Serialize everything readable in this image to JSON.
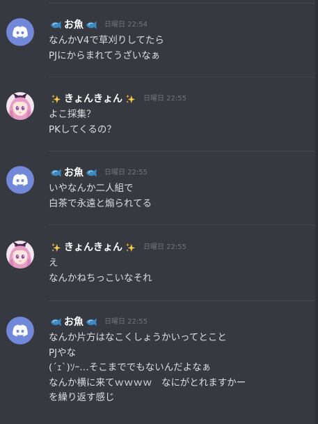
{
  "channel": {
    "messages": [
      {
        "username": "お魚",
        "avatar_icon": "discord-logo-icon",
        "name_icons": [
          "fish-icon",
          "fish-icon"
        ],
        "timestamp": "日曜日 22:54",
        "lines": [
          "なんかV4で草刈りしてたら",
          "PJにからまれてうざいなぁ"
        ]
      },
      {
        "username": "きょんきょん",
        "avatar_icon": "anime-girl-avatar-icon",
        "name_icons": [
          "sparkles-icon",
          "sparkles-icon"
        ],
        "timestamp": "日曜日 22:55",
        "lines": [
          "よこ採集？",
          "PKしてくるの？"
        ]
      },
      {
        "username": "お魚",
        "avatar_icon": "discord-logo-icon",
        "name_icons": [
          "fish-icon",
          "fish-icon"
        ],
        "timestamp": "日曜日 22:55",
        "lines": [
          "いやなんか二人組で",
          "白茶で永遠と煽られてる"
        ]
      },
      {
        "username": "きょんきょん",
        "avatar_icon": "anime-girl-avatar-icon",
        "name_icons": [
          "sparkles-icon",
          "sparkles-icon"
        ],
        "timestamp": "日曜日 22:55",
        "lines": [
          "え",
          "なんかねちっこいなそれ"
        ]
      },
      {
        "username": "お魚",
        "avatar_icon": "discord-logo-icon",
        "name_icons": [
          "fish-icon",
          "fish-icon"
        ],
        "timestamp": "日曜日 22:55",
        "lines": [
          "なんか片方はなこくしょうかいってとこと",
          "PJやな",
          "(´ｪ`)ｿｰ…そこまででもないんだよなぁ",
          "なんか横に来てｗｗｗｗ　なにがとれますかー",
          "を繰り返す感じ"
        ]
      }
    ]
  },
  "colors": {
    "background": "#36393f",
    "divider": "#42454a",
    "username": "#ffffff",
    "timestamp": "#72767d",
    "message_text": "#dcddde",
    "discord_blurple": "#7289da",
    "fish_blue": "#3b88c3",
    "sparkle_yellow": "#ffcc4d"
  }
}
